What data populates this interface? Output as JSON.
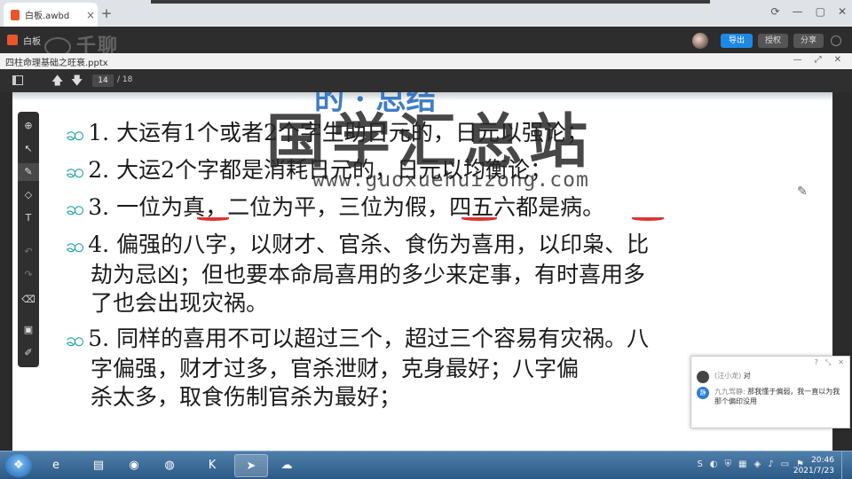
{
  "browser": {
    "tab_label": "白板.awbd",
    "tab_close": "×",
    "new_tab": "+",
    "window_controls": [
      "⟳",
      "—",
      "▢",
      "✕"
    ]
  },
  "app": {
    "name": "白板",
    "watermark_logo": "千聊",
    "export_label": "导出",
    "authorize_label": "授权",
    "share_label": "分享"
  },
  "document": {
    "title": "四柱命理基础之旺衰.pptx",
    "controls": [
      "—",
      "⤢",
      "✕"
    ]
  },
  "viewer": {
    "current_page": "14",
    "total_pages": "/ 18",
    "up_glyph": "🡅",
    "down_glyph": "🡇"
  },
  "slide": {
    "title": "的 · 总结",
    "bullet": "ဆ",
    "lines": [
      {
        "text": "1. 大运有1个或者2个字生助日元的，日元以强论；",
        "bullet": true
      },
      {
        "text": "2. 大运2个字都是消耗日元的，日元以均衡论；",
        "bullet": true
      },
      {
        "text": "3. 一位为真，二位为平，三位为假，四五六都是病。",
        "bullet": true
      },
      {
        "text": "4. 偏强的八字，以财才、官杀、食伤为喜用，以印枭、比",
        "bullet": true
      },
      {
        "text": "劫为忌凶；但也要本命局喜用的多少来定事，有时喜用多",
        "bullet": false
      },
      {
        "text": "了也会出现灾祸。",
        "bullet": false
      },
      {
        "text": "5. 同样的喜用不可以超过三个，超过三个容易有灾祸。八",
        "bullet": true
      },
      {
        "text": "字偏强，财才过多，官杀泄财，克身最好；八字偏",
        "bullet": false
      },
      {
        "text": "杀太多，取食伤制官杀为最好；",
        "bullet": false
      }
    ]
  },
  "overlay": {
    "watermark_text": "国学汇总站",
    "watermark_url": "www.guoxuehuizong.com"
  },
  "tools": [
    {
      "name": "add-slide-tool",
      "glyph": "⊕",
      "active": false,
      "dim": false
    },
    {
      "name": "select-tool",
      "glyph": "↖",
      "active": false,
      "dim": false
    },
    {
      "name": "pen-tool",
      "glyph": "✎",
      "active": true,
      "dim": false
    },
    {
      "name": "shape-tool",
      "glyph": "◇",
      "active": false,
      "dim": false
    },
    {
      "name": "text-tool",
      "glyph": "T",
      "active": false,
      "dim": false
    },
    {
      "name": "undo-tool",
      "glyph": "↶",
      "active": false,
      "dim": true
    },
    {
      "name": "redo-tool",
      "glyph": "↷",
      "active": false,
      "dim": true
    },
    {
      "name": "eraser-tool",
      "glyph": "⌫",
      "active": false,
      "dim": false
    },
    {
      "name": "toolbox-tool",
      "glyph": "▣",
      "active": false,
      "dim": false
    },
    {
      "name": "edit-tool",
      "glyph": "✐",
      "active": false,
      "dim": false
    }
  ],
  "chat": {
    "header_icons": [
      "?",
      "⤡",
      "✕"
    ],
    "messages": [
      {
        "sender": "(汪小龙)",
        "text": "对",
        "avatar": ""
      },
      {
        "sender": "九九驾静:",
        "text": "那我懂于偏弱，我一直以为我那个偏印没用",
        "avatar": "静"
      }
    ]
  },
  "taskbar": {
    "start_glyph": "❖",
    "apps": [
      {
        "name": "ie-icon",
        "glyph": "e",
        "on": false
      },
      {
        "name": "explorer-icon",
        "glyph": "▤",
        "on": false
      },
      {
        "name": "wechat-icon",
        "glyph": "◉",
        "on": false
      },
      {
        "name": "chrome-icon",
        "glyph": "◍",
        "on": false
      },
      {
        "name": "kugou-icon",
        "glyph": "K",
        "on": false
      },
      {
        "name": "feishu-icon",
        "glyph": "➤",
        "on": true
      },
      {
        "name": "cloud-icon",
        "glyph": "☁",
        "on": false
      }
    ],
    "tray_icons": [
      "S",
      "◐",
      "⛨",
      "▦",
      "◈",
      "♪",
      "▭",
      "⚑"
    ],
    "time": "20:46",
    "date": "2021/7/23"
  }
}
